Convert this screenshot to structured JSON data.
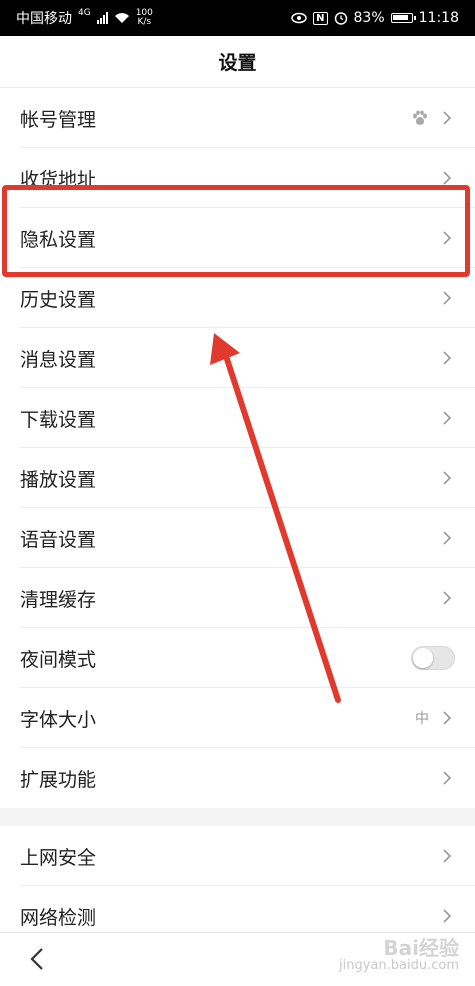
{
  "status_bar": {
    "carrier": "中国移动",
    "network": "4G",
    "speed_value": "100",
    "speed_unit": "K/s",
    "battery": "83%",
    "time": "11:18",
    "nfc": "N"
  },
  "header": {
    "title": "设置"
  },
  "group1": [
    {
      "label": "帐号管理",
      "icon": "baidu-paw-icon",
      "chevron": true
    },
    {
      "label": "收货地址",
      "chevron": true
    },
    {
      "label": "隐私设置",
      "chevron": true
    },
    {
      "label": "历史设置",
      "chevron": true
    },
    {
      "label": "消息设置",
      "chevron": true
    },
    {
      "label": "下载设置",
      "chevron": true
    },
    {
      "label": "播放设置",
      "chevron": true
    },
    {
      "label": "语音设置",
      "chevron": true
    },
    {
      "label": "清理缓存",
      "chevron": true
    },
    {
      "label": "夜间模式",
      "toggle": false
    },
    {
      "label": "字体大小",
      "value": "中",
      "chevron": true
    },
    {
      "label": "扩展功能",
      "chevron": true
    }
  ],
  "group2": [
    {
      "label": "上网安全",
      "chevron": true
    },
    {
      "label": "网络检测",
      "chevron": true
    }
  ],
  "watermark": {
    "brand": "Bai经验",
    "url": "jingyan.baidu.com"
  },
  "colors": {
    "annotation": "#e03a2f"
  }
}
